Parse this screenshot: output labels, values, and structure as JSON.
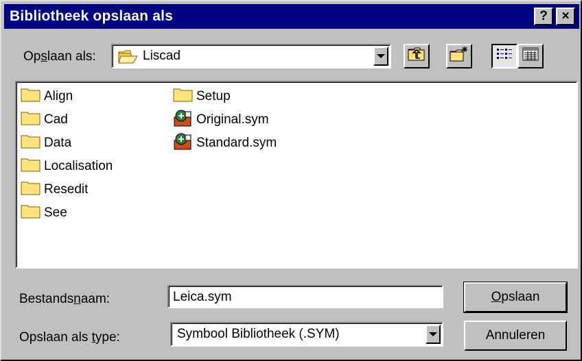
{
  "window": {
    "title": "Bibliotheek opslaan als",
    "help_label": "?",
    "close_label": "×"
  },
  "save_in": {
    "label_pre": "Op",
    "label_key": "s",
    "label_post": "laan als:",
    "value": "Liscad"
  },
  "files": [
    {
      "name": "Align",
      "type": "folder"
    },
    {
      "name": "Cad",
      "type": "folder"
    },
    {
      "name": "Data",
      "type": "folder"
    },
    {
      "name": "Localisation",
      "type": "folder"
    },
    {
      "name": "Resedit",
      "type": "folder"
    },
    {
      "name": "See",
      "type": "folder"
    },
    {
      "name": "Setup",
      "type": "folder"
    },
    {
      "name": "Original.sym",
      "type": "sym-file"
    },
    {
      "name": "Standard.sym",
      "type": "sym-file"
    }
  ],
  "filename": {
    "label_pre": "Bestands",
    "label_key": "n",
    "label_post": "aam:",
    "value": "Leica.sym"
  },
  "filetype": {
    "label_pre": "Opslaan als ",
    "label_key": "t",
    "label_post": "ype:",
    "value": "Symbool Bibliotheek (.SYM)"
  },
  "buttons": {
    "save_key": "O",
    "save_rest": "pslaan",
    "cancel": "Annuleren"
  },
  "colors": {
    "titlebar": "#000080",
    "face": "#c0c0c0",
    "folder": "#ffe27a"
  }
}
